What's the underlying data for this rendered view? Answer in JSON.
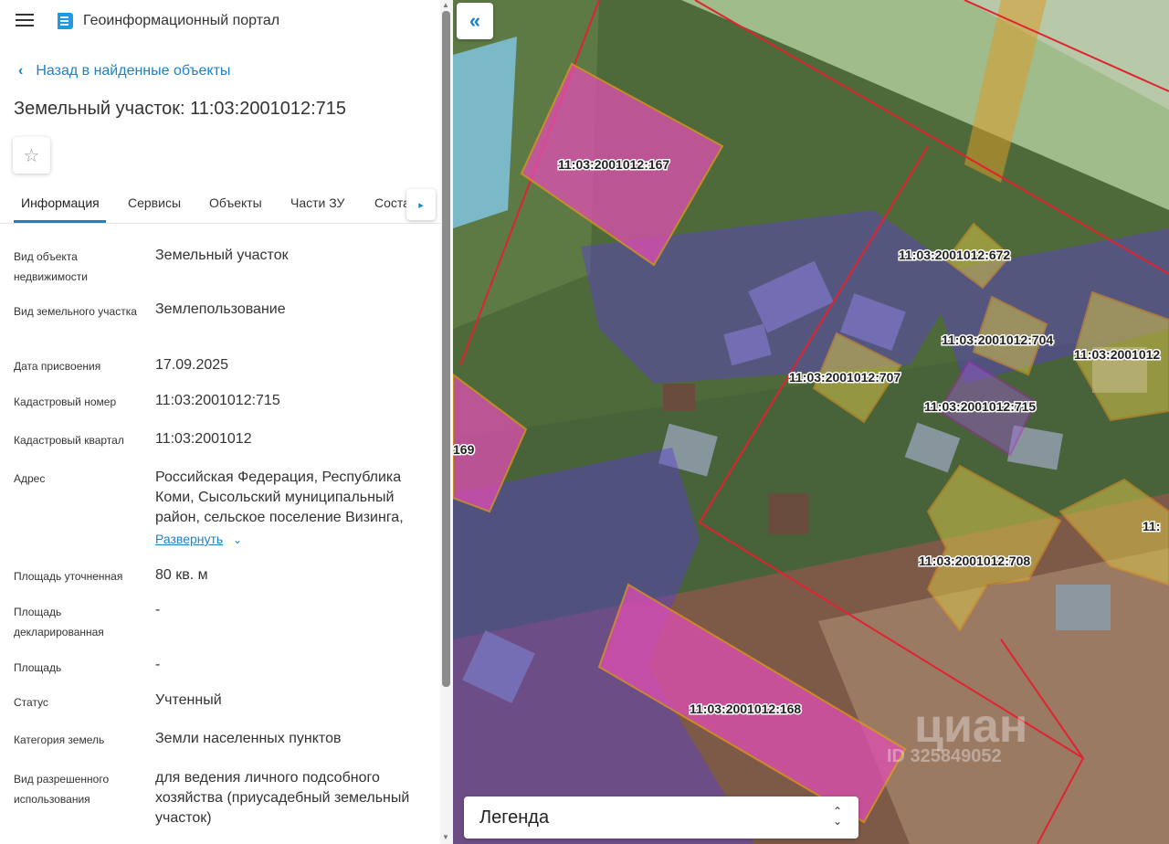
{
  "app": {
    "title": "Геоинформационный портал"
  },
  "nav": {
    "back_label": "Назад в найденные объекты"
  },
  "object": {
    "title": "Земельный участок: 11:03:2001012:715"
  },
  "tabs": [
    {
      "label": "Информация"
    },
    {
      "label": "Сервисы"
    },
    {
      "label": "Объекты"
    },
    {
      "label": "Части ЗУ"
    },
    {
      "label": "Соста"
    }
  ],
  "fields": [
    {
      "label": "Вид объекта недвижимости",
      "value": "Земельный участок"
    },
    {
      "label": "Вид земельного участка",
      "value": "Землепользование"
    },
    {
      "label": "Дата присвоения",
      "value": "17.09.2025"
    },
    {
      "label": "Кадастровый номер",
      "value": "11:03:2001012:715"
    },
    {
      "label": "Кадастровый квартал",
      "value": "11:03:2001012"
    },
    {
      "label": "Адрес",
      "value": "Российская Федерация, Республика Коми, Сысольский муниципальный район, сельское поселение Визинга,"
    },
    {
      "label": "Площадь уточненная",
      "value": "80 кв. м"
    },
    {
      "label": "Площадь декларированная",
      "value": "-"
    },
    {
      "label": "Площадь",
      "value": "-"
    },
    {
      "label": "Статус",
      "value": "Учтенный"
    },
    {
      "label": "Категория земель",
      "value": "Земли населенных пунктов"
    },
    {
      "label": "Вид разрешенного использования",
      "value": "для ведения личного подсобного хозяйства (приусадебный земельный участок)"
    }
  ],
  "expand_label": "Развернуть",
  "map": {
    "parcels": [
      {
        "label": "11:03:2001012:167"
      },
      {
        "label": "11:03:2001012:672"
      },
      {
        "label": "11:03:2001012:704"
      },
      {
        "label": "11:03:2001012:707"
      },
      {
        "label": "11:03:2001012:715"
      },
      {
        "label": "11:03:2001012:708"
      },
      {
        "label": "11:03:2001012:168"
      },
      {
        "label": "169"
      },
      {
        "label": "11:03:2001012"
      },
      {
        "label": "11:"
      }
    ],
    "watermark": "циан",
    "watermark_id": "ID 325849052"
  },
  "legend": {
    "label": "Легенда"
  },
  "colors": {
    "accent": "#1e82c8"
  }
}
